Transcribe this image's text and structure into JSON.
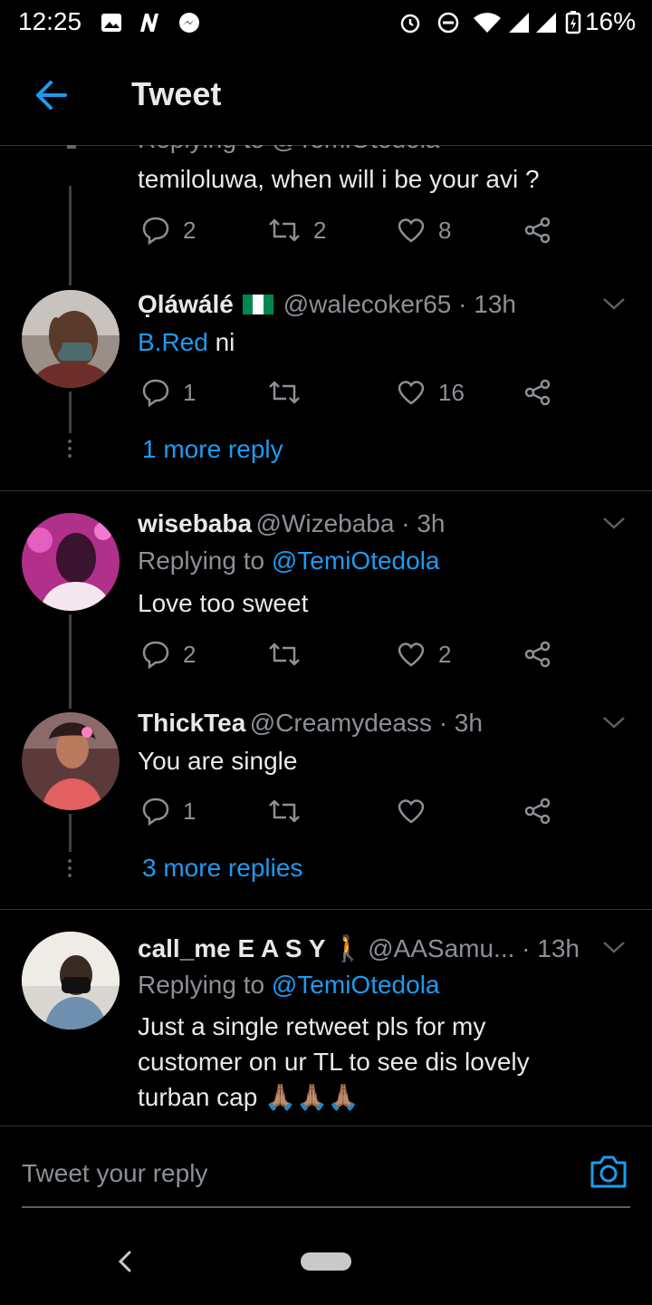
{
  "status_bar": {
    "time": "12:25",
    "battery": "16%"
  },
  "header": {
    "title": "Tweet"
  },
  "tweets": [
    {
      "partial_reply": "Replying to @TemiOtedola",
      "text": "temiloluwa, when will i be your avi ?",
      "replies": "2",
      "retweets": "2",
      "likes": "8"
    },
    {
      "name": "Ọláwálé",
      "handle": "@walecoker65 · 13h",
      "mention": "B.Red",
      "text_suffix": " ni",
      "replies": "1",
      "retweets": "",
      "likes": "16",
      "more": "1 more reply"
    },
    {
      "name": "wisebaba",
      "handle": "@Wizebaba · 3h",
      "replying_prefix": "Replying to ",
      "replying_to": "@TemiOtedola",
      "text": "Love too sweet",
      "replies": "2",
      "retweets": "",
      "likes": "2"
    },
    {
      "name": "ThickTea",
      "handle": "@Creamydeass · 3h",
      "text": "You are single",
      "replies": "1",
      "retweets": "",
      "likes": "",
      "more": "3 more replies"
    },
    {
      "name": "call_me E A S Y 🚶",
      "handle": "@AASamu... · 13h",
      "replying_prefix": "Replying to ",
      "replying_to": "@TemiOtedola",
      "text_lines": [
        "Just a single retweet pls for my",
        "customer on ur TL to see dis lovely",
        "turban cap 🙏🏽🙏🏽🙏🏽"
      ]
    }
  ],
  "reply_bar": {
    "placeholder": "Tweet your reply"
  },
  "colors": {
    "accent": "#1d9bf0",
    "background": "#000000",
    "secondary_text": "#8b9096"
  }
}
